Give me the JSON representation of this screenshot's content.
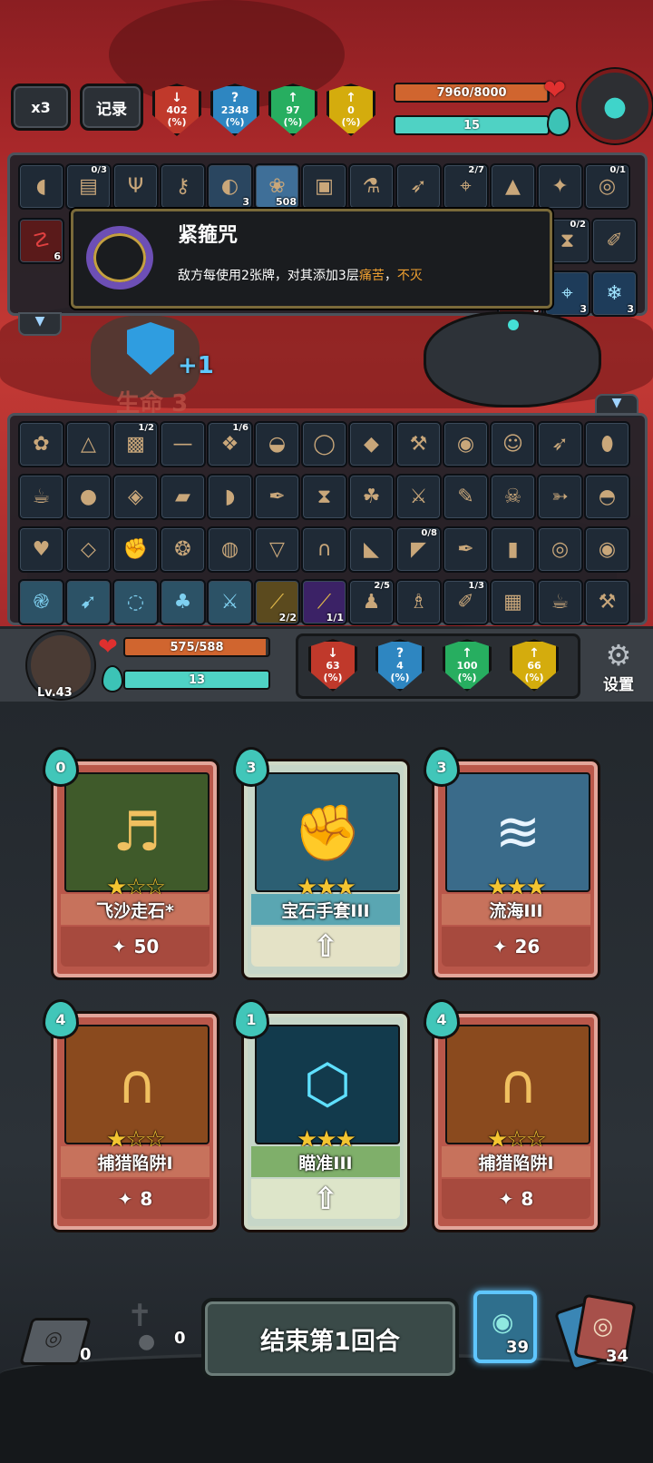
{
  "top_hud": {
    "speed_label": "x3",
    "record_label": "记录",
    "stats": [
      {
        "icon": "attack-down-icon",
        "value": "402",
        "unit": "(%)",
        "color": "#c0392b"
      },
      {
        "icon": "mystery-icon",
        "value": "2348",
        "unit": "(%)",
        "color": "#2e86c1"
      },
      {
        "icon": "defense-icon",
        "value": "97",
        "unit": "(%)",
        "color": "#27ae60"
      },
      {
        "icon": "buff-icon",
        "value": "0",
        "unit": "(%)",
        "color": "#d4ac0d"
      }
    ],
    "enemy_hp": {
      "text": "7960/8000",
      "fraction": 0.995
    },
    "enemy_energy": {
      "text": "15",
      "fraction": 1.0
    }
  },
  "enemy_relics": {
    "row1": [
      {
        "icon": "meat-icon",
        "count": ""
      },
      {
        "icon": "book-icon",
        "count": "",
        "top": "0/3"
      },
      {
        "icon": "trident-icon",
        "count": ""
      },
      {
        "icon": "key-icon",
        "count": ""
      },
      {
        "icon": "moon-orb-icon",
        "count": "3"
      },
      {
        "icon": "ghost-icon",
        "count": "508"
      },
      {
        "icon": "tome-icon",
        "count": ""
      },
      {
        "icon": "potion-icon",
        "count": ""
      },
      {
        "icon": "arrows-icon",
        "count": ""
      },
      {
        "icon": "compass-icon",
        "count": "",
        "top": "2/7"
      },
      {
        "icon": "tent-icon",
        "count": ""
      },
      {
        "icon": "wing-icon",
        "count": ""
      },
      {
        "icon": "ring-icon",
        "count": "",
        "top": "0/1"
      }
    ],
    "row2_left": {
      "icon": "claw-icon",
      "count": "6"
    },
    "row2_right": [
      {
        "icon": "hourglass-icon",
        "count": "",
        "top": "0/2"
      },
      {
        "icon": "scroll-icon",
        "count": ""
      }
    ],
    "row3_right": [
      {
        "icon": "fire-icon",
        "count": "0"
      },
      {
        "icon": "target-icon",
        "count": "3"
      },
      {
        "icon": "snowflake-icon",
        "count": "3"
      }
    ]
  },
  "tooltip": {
    "title": "紧箍咒",
    "desc_before": "敌方每使用2张牌，对其添加3层",
    "keyword1": "痛苦",
    "sep": "，",
    "keyword2": "不灭"
  },
  "battle": {
    "shield_value": "+1",
    "life_label": "生命",
    "life_suffix": "3"
  },
  "player_relics": [
    [
      "rose-icon",
      "bag-icon",
      {
        "icon": "armor-icon",
        "top": "1/2"
      },
      "bone-icon",
      {
        "icon": "gift-icon",
        "top": "1/6"
      },
      "helmet-icon",
      "bracelet-icon",
      "crystal-icon",
      "hammer-icon",
      "pot-icon",
      "ghost-face-icon",
      "arrows-icon",
      "egg-icon"
    ],
    [
      "teacup-icon",
      "apple-icon",
      "owl-icon",
      "sack-icon",
      "ham-icon",
      "quill-icon",
      "hourglass-icon",
      "leaf-icon",
      "knife-icon",
      "brush-icon",
      "skull-icon",
      "bow-icon",
      "pudding-icon"
    ],
    [
      "heart-icon",
      "leaf-gem-icon",
      "glove-icon",
      "rope-icon",
      "crystal-ball-icon",
      "pouch-icon",
      "trap-icon",
      "boot-icon",
      {
        "icon": "fang-icon",
        "top": "0/8"
      },
      "fish-icon",
      "can-icon",
      "ring-icon",
      "shield-round-icon"
    ],
    [
      "swirl-icon",
      "bow-rune-icon",
      "pig-icon",
      "tree-icon",
      "swords-icon",
      {
        "icon": "telescope-icon",
        "count": "2/2"
      },
      {
        "icon": "telescope-purple-icon",
        "count": "1/1"
      },
      {
        "icon": "figure-icon",
        "top": "2/5"
      },
      "mage-icon",
      {
        "icon": "scroll-rune-icon",
        "top": "1/3"
      },
      "card-icon",
      "gravy-icon",
      "mallet-icon"
    ]
  ],
  "player": {
    "level": "Lv.43",
    "hp": {
      "text": "575/588",
      "fraction": 0.978
    },
    "energy": {
      "text": "13",
      "fraction": 1.0
    },
    "stats": [
      {
        "icon": "attack-down-icon",
        "value": "63",
        "unit": "(%)",
        "color": "#c0392b"
      },
      {
        "icon": "mystery-icon",
        "value": "4",
        "unit": "(%)",
        "color": "#2e86c1"
      },
      {
        "icon": "defense-icon",
        "value": "100",
        "unit": "(%)",
        "color": "#27ae60"
      },
      {
        "icon": "buff-icon",
        "value": "66",
        "unit": "(%)",
        "color": "#d4ac0d"
      }
    ],
    "settings_label": "设置"
  },
  "hand": [
    {
      "cost": "0",
      "name": "飞沙走石*",
      "value": "50",
      "stars": 1,
      "theme": "red",
      "art": "bells-icon",
      "upgrade": false
    },
    {
      "cost": "3",
      "name": "宝石手套III",
      "value": "",
      "stars": 3,
      "theme": "blue",
      "art": "gem-glove-icon",
      "upgrade": true
    },
    {
      "cost": "3",
      "name": "流海III",
      "value": "26",
      "stars": 3,
      "theme": "red",
      "art": "wave-icon",
      "upgrade": false
    },
    {
      "cost": "4",
      "name": "捕猎陷阱I",
      "value": "8",
      "stars": 1,
      "theme": "red",
      "art": "bear-trap-icon",
      "upgrade": false
    },
    {
      "cost": "1",
      "name": "瞄准III",
      "value": "",
      "stars": 3,
      "theme": "green",
      "art": "crosshair-icon",
      "upgrade": true
    },
    {
      "cost": "4",
      "name": "捕猎陷阱I",
      "value": "8",
      "stars": 1,
      "theme": "red",
      "art": "bear-trap-icon",
      "upgrade": false
    }
  ],
  "bottom": {
    "exhaust_count": "0",
    "grave_count": "0",
    "end_turn_label": "结束第1回合",
    "draw_count": "39",
    "discard_count": "34"
  }
}
